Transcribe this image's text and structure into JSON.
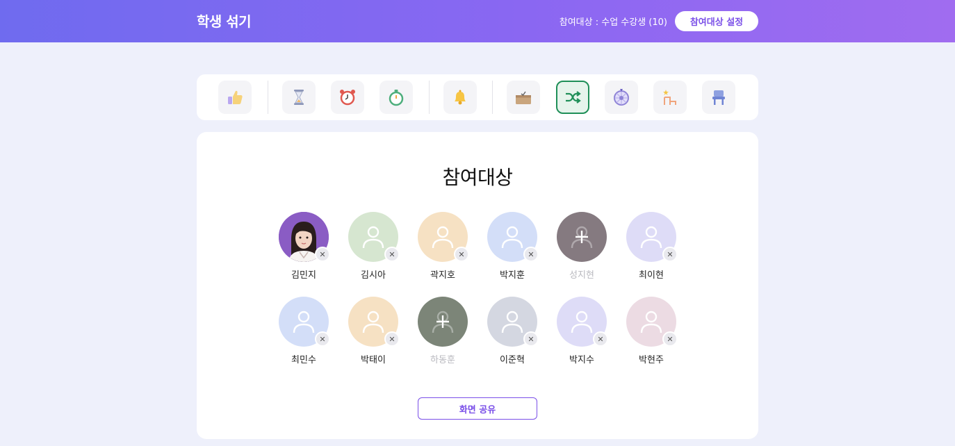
{
  "header": {
    "title": "학생 섞기",
    "participants_summary": "참여대상 : 수업 수강생 (10)",
    "settings_button": "참여대상 설정"
  },
  "toolbar": {
    "tools": [
      {
        "icon": "thumbs-up-icon",
        "active": false
      },
      {
        "icon": "hourglass-icon",
        "active": false
      },
      {
        "icon": "alarm-clock-icon",
        "active": false
      },
      {
        "icon": "stopwatch-icon",
        "active": false
      },
      {
        "icon": "bell-icon",
        "active": false
      },
      {
        "icon": "box-icon",
        "active": false
      },
      {
        "icon": "shuffle-icon",
        "active": true
      },
      {
        "icon": "roulette-icon",
        "active": false
      },
      {
        "icon": "seat-layout-icon",
        "active": false
      },
      {
        "icon": "chair-icon",
        "active": false
      }
    ],
    "active_color": "#1f8f58"
  },
  "panel": {
    "title": "참여대상",
    "share_button": "화면 공유",
    "students": [
      {
        "name": "김민지",
        "color": "#8a5cc4",
        "photo": true,
        "excluded": false
      },
      {
        "name": "김시아",
        "color": "#d6e6d0",
        "photo": false,
        "excluded": false
      },
      {
        "name": "곽지호",
        "color": "#f6e1c3",
        "photo": false,
        "excluded": false
      },
      {
        "name": "박지훈",
        "color": "#d3def8",
        "photo": false,
        "excluded": false
      },
      {
        "name": "성지현",
        "color": "#857a80",
        "photo": false,
        "excluded": true
      },
      {
        "name": "최이현",
        "color": "#dedcf7",
        "photo": false,
        "excluded": false
      },
      {
        "name": "최민수",
        "color": "#d3def8",
        "photo": false,
        "excluded": false
      },
      {
        "name": "박태이",
        "color": "#f6e1c3",
        "photo": false,
        "excluded": false
      },
      {
        "name": "하동훈",
        "color": "#7c8578",
        "photo": false,
        "excluded": true
      },
      {
        "name": "이준혁",
        "color": "#d4d7e1",
        "photo": false,
        "excluded": false
      },
      {
        "name": "박지수",
        "color": "#dedcf7",
        "photo": false,
        "excluded": false
      },
      {
        "name": "박현주",
        "color": "#ecdbe3",
        "photo": false,
        "excluded": false
      }
    ]
  },
  "colors": {
    "accent": "#7a4fe8",
    "background": "#eef0fb"
  }
}
